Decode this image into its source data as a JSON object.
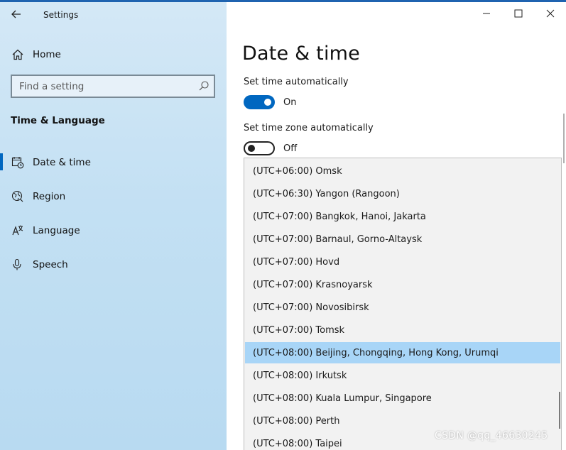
{
  "window": {
    "title": "Settings",
    "controls": [
      "minimize",
      "maximize",
      "close"
    ]
  },
  "sidebar": {
    "home_label": "Home",
    "search_placeholder": "Find a setting",
    "section_title": "Time & Language",
    "items": [
      {
        "label": "Date & time",
        "icon": "calendar-clock-icon",
        "active": true
      },
      {
        "label": "Region",
        "icon": "globe-icon",
        "active": false
      },
      {
        "label": "Language",
        "icon": "language-icon",
        "active": false
      },
      {
        "label": "Speech",
        "icon": "microphone-icon",
        "active": false
      }
    ]
  },
  "main": {
    "title": "Date & time",
    "settings": [
      {
        "label": "Set time automatically",
        "state": "On",
        "on": true
      },
      {
        "label": "Set time zone automatically",
        "state": "Off",
        "on": false
      }
    ]
  },
  "timezones": {
    "selected_index": 8,
    "items": [
      "(UTC+06:00) Omsk",
      "(UTC+06:30) Yangon (Rangoon)",
      "(UTC+07:00) Bangkok, Hanoi, Jakarta",
      "(UTC+07:00) Barnaul, Gorno-Altaysk",
      "(UTC+07:00) Hovd",
      "(UTC+07:00) Krasnoyarsk",
      "(UTC+07:00) Novosibirsk",
      "(UTC+07:00) Tomsk",
      "(UTC+08:00) Beijing, Chongqing, Hong Kong, Urumqi",
      "(UTC+08:00) Irkutsk",
      "(UTC+08:00) Kuala Lumpur, Singapore",
      "(UTC+08:00) Perth",
      "(UTC+08:00) Taipei"
    ]
  },
  "watermark": "CSDN @qq_46630245",
  "colors": {
    "accent": "#0067c0",
    "selected_row": "#a8d5f7",
    "sidebar_bg": "#c3e0f3"
  }
}
